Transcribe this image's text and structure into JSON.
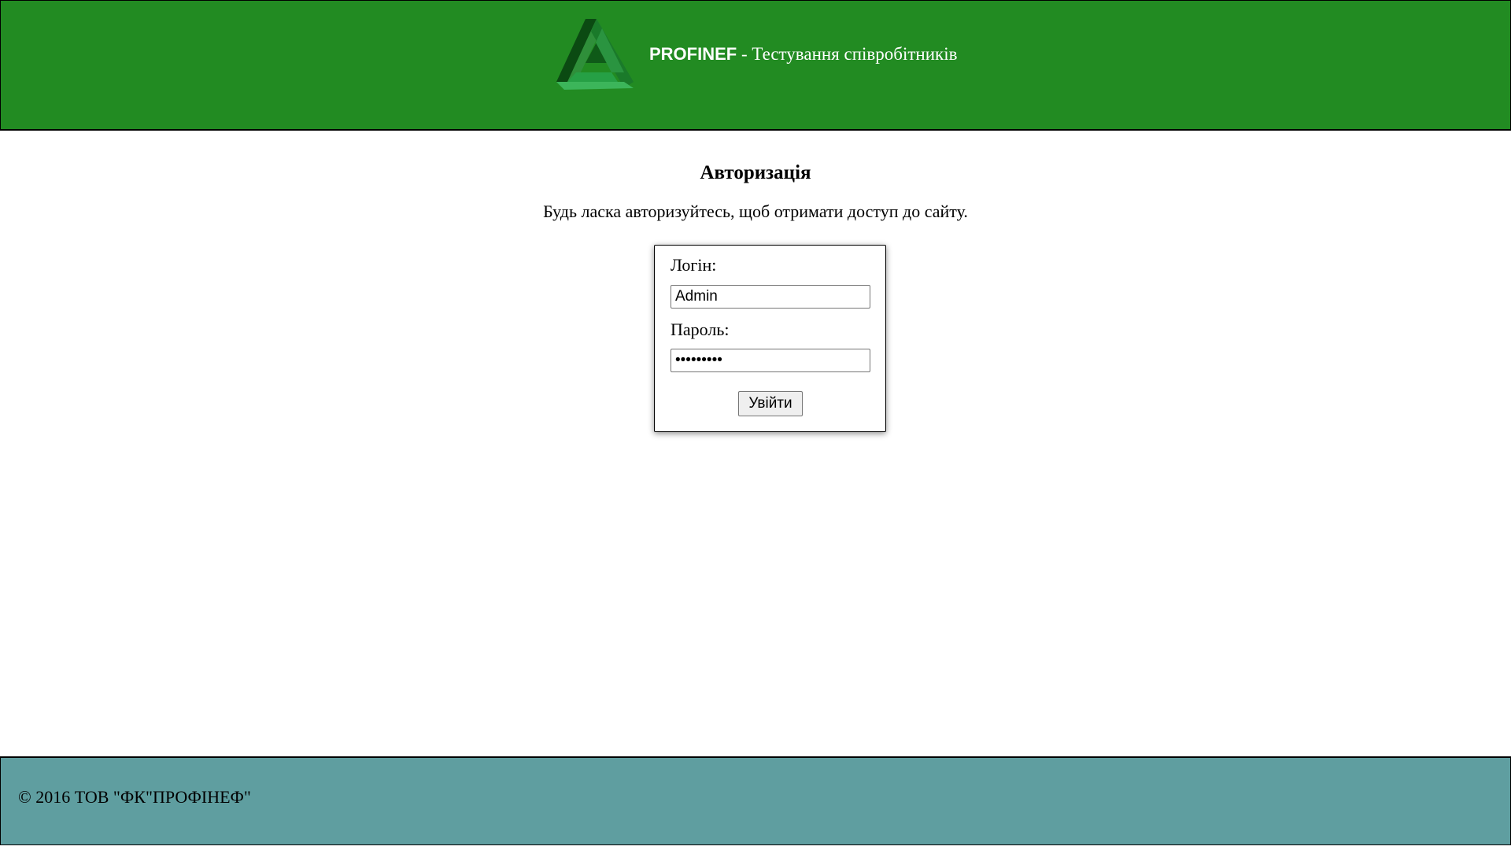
{
  "header": {
    "brand_name": "PROFINEF",
    "brand_subtitle": " - Тестування співробітників",
    "logo_icon": "penrose-triangle-logo",
    "background_color": "#228b22"
  },
  "main": {
    "title": "Авторизація",
    "subtitle": "Будь ласка авторизуйтесь, щоб отримати доступ до сайту.",
    "form": {
      "login_label": "Логін:",
      "login_value": "Admin",
      "password_label": "Пароль:",
      "password_value": "123456789",
      "submit_label": "Увійти"
    }
  },
  "footer": {
    "copyright": "© 2016 ТОВ \"ФК\"ПРОФІНЕФ\"",
    "background_color": "#5f9ea0"
  }
}
